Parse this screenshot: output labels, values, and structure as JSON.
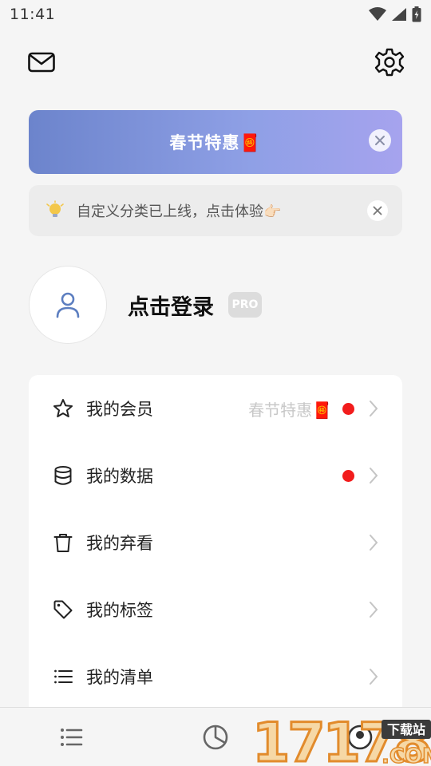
{
  "status_bar": {
    "time": "11:41",
    "icons": [
      "wifi-icon",
      "signal-icon",
      "battery-charging-icon"
    ]
  },
  "header": {
    "left_icon": "mail-icon",
    "right_icon": "gear-icon"
  },
  "promo_banner": {
    "text": "春节特惠🧧",
    "close_icon": "close-icon",
    "gradient": [
      "#6c84cc",
      "#a6a3ee"
    ]
  },
  "notice": {
    "icon": "lightbulb-icon",
    "text": "自定义分类已上线，点击体验👉🏻",
    "close_icon": "close-icon"
  },
  "profile": {
    "avatar_icon": "user-icon",
    "login_text": "点击登录",
    "badge": "PRO"
  },
  "menu": {
    "items": [
      {
        "icon": "star-icon",
        "label": "我的会员",
        "sub": "春节特惠🧧",
        "dot": true
      },
      {
        "icon": "database-icon",
        "label": "我的数据",
        "sub": "",
        "dot": true
      },
      {
        "icon": "trash-icon",
        "label": "我的弃看",
        "sub": "",
        "dot": false
      },
      {
        "icon": "tag-icon",
        "label": "我的标签",
        "sub": "",
        "dot": false
      },
      {
        "icon": "list-icon",
        "label": "我的清单",
        "sub": "",
        "dot": false
      }
    ]
  },
  "bottom_nav": {
    "items": [
      "list-icon",
      "pie-chart-icon",
      "profile-icon"
    ]
  },
  "watermark": {
    "text": "17178",
    "sub": "下载站",
    "domain": ".COM"
  },
  "colors": {
    "accent": "#6c84cc",
    "dot": "#f21c1c",
    "background": "#f5f5f5"
  }
}
